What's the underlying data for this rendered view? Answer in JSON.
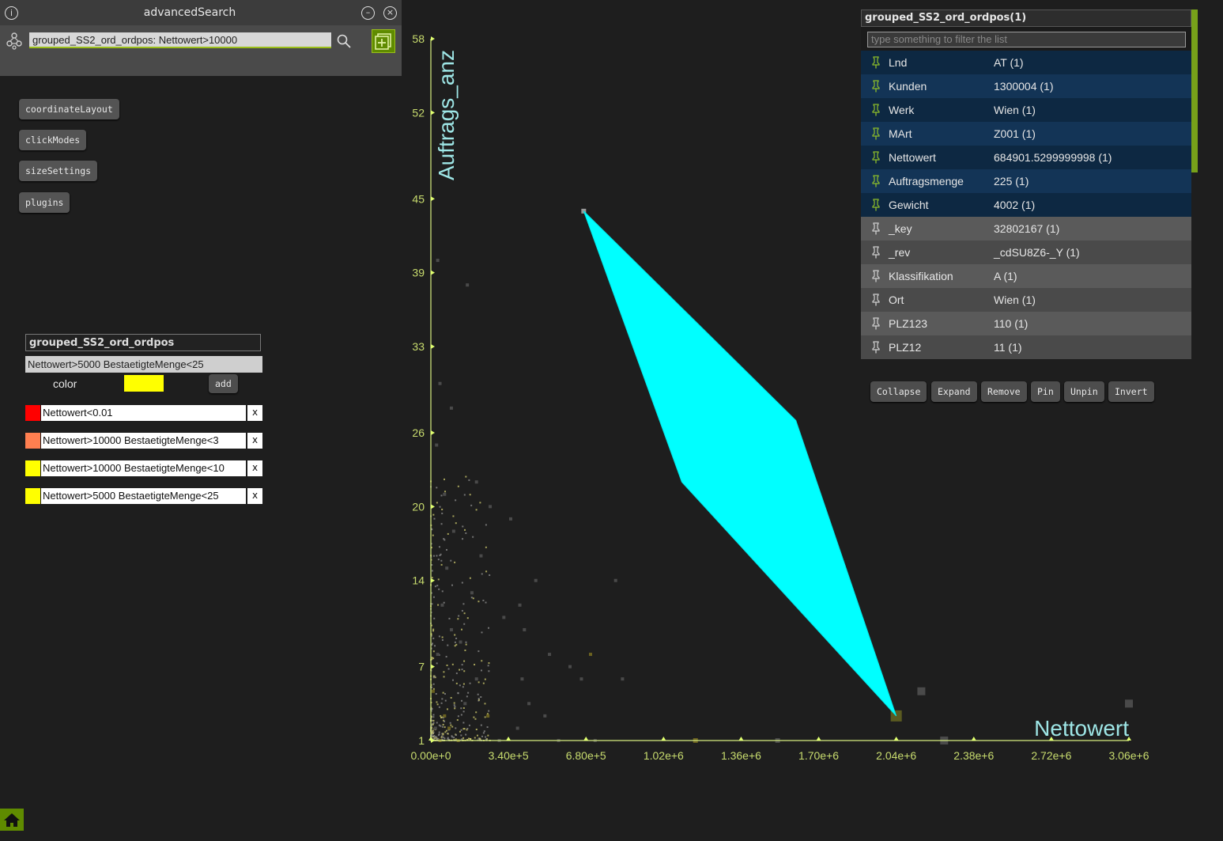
{
  "search": {
    "title": "advancedSearch",
    "query": "grouped_SS2_ord_ordpos: Nettowert>10000",
    "info_icon": "info-icon",
    "minimize_icon": "minimize-icon",
    "close_icon": "close-icon",
    "graph_icon": "graph-nodes-icon",
    "search_icon": "search-icon",
    "add_icon": "add-box-icon"
  },
  "menu": {
    "items": [
      "coordinateLayout",
      "clickModes",
      "sizeSettings",
      "plugins"
    ]
  },
  "legend": {
    "collection": "grouped_SS2_ord_ordpos",
    "query": "Nettowert>5000 BestaetigteMenge<25",
    "color_label": "color",
    "picked_color": "#ffff00",
    "add_label": "add",
    "rules": [
      {
        "color": "#ff0000",
        "text": "Nettowert<0.01",
        "remove": "x"
      },
      {
        "color": "#ff7f50",
        "text": "Nettowert>10000 BestaetigteMenge<3",
        "remove": "x"
      },
      {
        "color": "#ffff00",
        "text": "Nettowert>10000 BestaetigteMenge<10",
        "remove": "x"
      },
      {
        "color": "#ffff00",
        "text": "Nettowert>5000 BestaetigteMenge<25",
        "remove": "x"
      }
    ]
  },
  "list": {
    "title": "grouped_SS2_ord_ordpos(1)",
    "filter_placeholder": "type something to filter the list",
    "rows": [
      {
        "key": "Lnd",
        "value": "AT (1)",
        "pinned": true
      },
      {
        "key": "Kunden",
        "value": "1300004 (1)",
        "pinned": true
      },
      {
        "key": "Werk",
        "value": "Wien (1)",
        "pinned": true
      },
      {
        "key": "MArt",
        "value": "Z001 (1)",
        "pinned": true
      },
      {
        "key": "Nettowert",
        "value": "684901.5299999998 (1)",
        "pinned": true
      },
      {
        "key": "Auftragsmenge",
        "value": "225 (1)",
        "pinned": true
      },
      {
        "key": "Gewicht",
        "value": "4002 (1)",
        "pinned": true
      },
      {
        "key": "_key",
        "value": "32802167 (1)",
        "pinned": false
      },
      {
        "key": "_rev",
        "value": "_cdSU8Z6-_Y (1)",
        "pinned": false
      },
      {
        "key": "Klassifikation",
        "value": "A (1)",
        "pinned": false
      },
      {
        "key": "Ort",
        "value": "Wien (1)",
        "pinned": false
      },
      {
        "key": "PLZ123",
        "value": "110 (1)",
        "pinned": false
      },
      {
        "key": "PLZ12",
        "value": "11 (1)",
        "pinned": false
      }
    ],
    "actions": [
      "Collapse",
      "Expand",
      "Remove",
      "Pin",
      "Unpin",
      "Invert"
    ]
  },
  "colors": {
    "accent": "#77a11a",
    "pinned_row_dark": "#0d2842",
    "pinned_row_light": "#133456",
    "unpinned_row_dark": "#4a4a4a",
    "unpinned_row_light": "#5a5a5a",
    "highlight": "#00ffff",
    "axis": "#d8ef80"
  },
  "home_icon": "home-icon",
  "chart_data": {
    "type": "scatter",
    "xlabel": "Nettowert",
    "ylabel": "Auftrags_anz",
    "xlim": [
      0,
      3060000
    ],
    "ylim": [
      0,
      58
    ],
    "x_ticks": [
      "0.00e+0",
      "3.40e+5",
      "6.80e+5",
      "1.02e+6",
      "1.36e+6",
      "1.70e+6",
      "2.04e+6",
      "2.38e+6",
      "2.72e+6",
      "3.06e+6"
    ],
    "x_tick_values": [
      0,
      340000,
      680000,
      1020000,
      1360000,
      1700000,
      2040000,
      2380000,
      2720000,
      3060000
    ],
    "y_ticks": [
      "1",
      "7",
      "14",
      "20",
      "26",
      "33",
      "39",
      "45",
      "52",
      "58"
    ],
    "y_tick_values": [
      1,
      7,
      14,
      20,
      26,
      33,
      39,
      45,
      52,
      58
    ],
    "grid": false,
    "highlight_polygon": [
      [
        670000,
        44
      ],
      [
        1600000,
        27
      ],
      [
        2040000,
        3
      ],
      [
        1100000,
        22
      ]
    ],
    "points": [
      {
        "x": 20000,
        "y": 2,
        "c": "gray"
      },
      {
        "x": 40000,
        "y": 1,
        "c": "yellow"
      },
      {
        "x": 60000,
        "y": 3,
        "c": "yellow"
      },
      {
        "x": 10000,
        "y": 5,
        "c": "yellow"
      },
      {
        "x": 80000,
        "y": 2,
        "c": "yellow"
      },
      {
        "x": 120000,
        "y": 1,
        "c": "yellow"
      },
      {
        "x": 150000,
        "y": 4,
        "c": "gray"
      },
      {
        "x": 30000,
        "y": 8,
        "c": "gray"
      },
      {
        "x": 50000,
        "y": 12,
        "c": "gray"
      },
      {
        "x": 90000,
        "y": 10,
        "c": "gray"
      },
      {
        "x": 70000,
        "y": 15,
        "c": "gray"
      },
      {
        "x": 100000,
        "y": 18,
        "c": "gray"
      },
      {
        "x": 25000,
        "y": 25,
        "c": "gray"
      },
      {
        "x": 60000,
        "y": 21,
        "c": "gray"
      },
      {
        "x": 200000,
        "y": 6,
        "c": "gray"
      },
      {
        "x": 250000,
        "y": 3,
        "c": "yellow"
      },
      {
        "x": 300000,
        "y": 1,
        "c": "gray"
      },
      {
        "x": 320000,
        "y": 11,
        "c": "gray"
      },
      {
        "x": 380000,
        "y": 2,
        "c": "gray"
      },
      {
        "x": 400000,
        "y": 6,
        "c": "gray"
      },
      {
        "x": 430000,
        "y": 4,
        "c": "gray"
      },
      {
        "x": 460000,
        "y": 14,
        "c": "gray"
      },
      {
        "x": 500000,
        "y": 3,
        "c": "gray"
      },
      {
        "x": 520000,
        "y": 8,
        "c": "gray"
      },
      {
        "x": 560000,
        "y": 1,
        "c": "gray"
      },
      {
        "x": 610000,
        "y": 7,
        "c": "gray"
      },
      {
        "x": 660000,
        "y": 6,
        "c": "gray"
      },
      {
        "x": 700000,
        "y": 8,
        "c": "yellow"
      },
      {
        "x": 720000,
        "y": 1,
        "c": "gray"
      },
      {
        "x": 810000,
        "y": 14,
        "c": "gray"
      },
      {
        "x": 840000,
        "y": 6,
        "c": "gray"
      },
      {
        "x": 1160000,
        "y": 1,
        "c": "yellow"
      },
      {
        "x": 1520000,
        "y": 1,
        "c": "gray"
      },
      {
        "x": 2150000,
        "y": 5,
        "c": "gray"
      },
      {
        "x": 2250000,
        "y": 1,
        "c": "gray"
      },
      {
        "x": 3060000,
        "y": 4,
        "c": "gray"
      },
      {
        "x": 40000,
        "y": 30,
        "c": "gray"
      },
      {
        "x": 30000,
        "y": 40,
        "c": "gray"
      },
      {
        "x": 160000,
        "y": 38,
        "c": "gray"
      },
      {
        "x": 200000,
        "y": 22,
        "c": "gray"
      },
      {
        "x": 260000,
        "y": 20,
        "c": "gray"
      },
      {
        "x": 350000,
        "y": 19,
        "c": "gray"
      },
      {
        "x": 390000,
        "y": 12,
        "c": "gray"
      },
      {
        "x": 410000,
        "y": 10,
        "c": "gray"
      },
      {
        "x": 130000,
        "y": 9,
        "c": "gray"
      },
      {
        "x": 180000,
        "y": 13,
        "c": "gray"
      },
      {
        "x": 220000,
        "y": 16,
        "c": "gray"
      },
      {
        "x": 90000,
        "y": 28,
        "c": "gray"
      }
    ]
  }
}
